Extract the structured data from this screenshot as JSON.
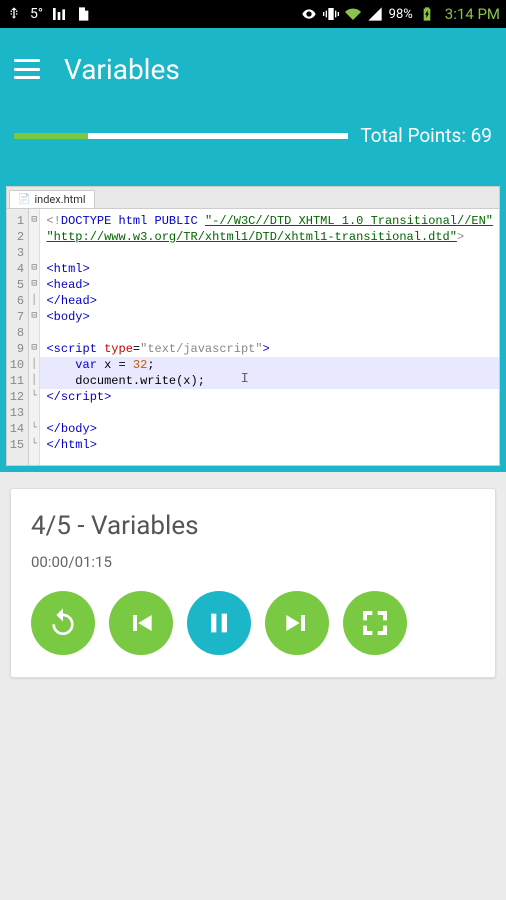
{
  "status": {
    "temp": "5°",
    "battery_pct": "98%",
    "time": "3:14 PM"
  },
  "header": {
    "title": "Variables",
    "total_points": "Total Points: 69",
    "progress_pct": 22
  },
  "editor": {
    "filename": "index.html",
    "lines": [
      "<!DOCTYPE html PUBLIC \"-//W3C//DTD XHTML 1.0 Transitional//EN\"",
      "\"http://www.w3.org/TR/xhtml1/DTD/xhtml1-transitional.dtd\">",
      "",
      "<html>",
      "<head>",
      "</head>",
      "<body>",
      "",
      "<script type=\"text/javascript\">",
      "    var x = 32;",
      "    document.write(x);",
      "</script>",
      "",
      "</body>",
      "</html>"
    ]
  },
  "player": {
    "lesson_title": "4/5 - Variables",
    "time_current": "00:00",
    "time_total": "01:15"
  }
}
